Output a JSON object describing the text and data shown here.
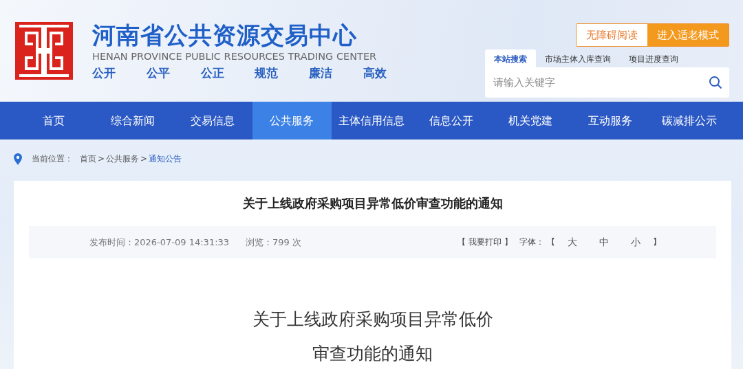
{
  "header": {
    "title": "河南省公共资源交易中心",
    "subtitle": "HENAN PROVINCE PUBLIC RESOURCES TRADING CENTER",
    "mottos": [
      "公开",
      "公平",
      "公正",
      "规范",
      "廉洁",
      "高效"
    ],
    "mode_buttons": [
      {
        "label": "无障碍阅读",
        "kind": "outline"
      },
      {
        "label": "进入适老模式",
        "kind": "filled"
      }
    ],
    "search_tabs": [
      {
        "label": "本站搜索",
        "selected": true
      },
      {
        "label": "市场主体入库查询",
        "selected": false
      },
      {
        "label": "项目进度查询",
        "selected": false
      }
    ],
    "search": {
      "placeholder": "请输入关键字"
    }
  },
  "nav": [
    {
      "label": "首页",
      "selected": false
    },
    {
      "label": "综合新闻",
      "selected": false
    },
    {
      "label": "交易信息",
      "selected": false
    },
    {
      "label": "公共服务",
      "selected": true
    },
    {
      "label": "主体信用信息",
      "selected": false
    },
    {
      "label": "信息公开",
      "selected": false
    },
    {
      "label": "机关党建",
      "selected": false
    },
    {
      "label": "互动服务",
      "selected": false
    },
    {
      "label": "碳减排公示",
      "selected": false
    }
  ],
  "breadcrumb": {
    "label": "当前位置：",
    "items": [
      {
        "label": "首页",
        "separator": ">",
        "selected": false
      },
      {
        "label": "公共服务",
        "separator": ">",
        "selected": false
      },
      {
        "label": "通知公告",
        "selected": true
      }
    ]
  },
  "article": {
    "title": "关于上线政府采购项目异常低价审查功能的通知",
    "meta": {
      "published": "发布时间：2026-07-09 14:31:33",
      "views": "浏览：799 次",
      "print": "【 我要打印 】",
      "font_label": "字体：",
      "open_bracket": "【",
      "font_sizes": [
        "大",
        "中",
        "小"
      ],
      "close_bracket": "】"
    },
    "body_title": [
      "关于上线政府采购项目异常低价",
      "审查功能的通知"
    ]
  }
}
